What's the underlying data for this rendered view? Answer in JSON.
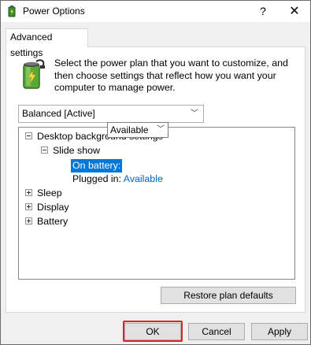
{
  "window": {
    "title": "Power Options",
    "help_glyph": "?",
    "close_glyph": "✕"
  },
  "tab": {
    "label": "Advanced settings"
  },
  "intro": {
    "line1": "Select the power plan that you want to customize, and",
    "line2": "then choose settings that reflect how you want your",
    "line3": "computer to manage power."
  },
  "plan": {
    "selected": "Balanced [Active]"
  },
  "tree": {
    "desktop_bg": "Desktop background settings",
    "slide_show": "Slide show",
    "on_battery_label": "On battery:",
    "on_battery_value": "Available",
    "plugged_in_label": "Plugged in:",
    "plugged_in_value": "Available",
    "sleep": "Sleep",
    "display": "Display",
    "battery": "Battery"
  },
  "buttons": {
    "restore": "Restore plan defaults",
    "ok": "OK",
    "cancel": "Cancel",
    "apply": "Apply"
  },
  "colors": {
    "selection": "#0078d7",
    "link": "#0066cc",
    "highlight_box": "#e0202c"
  }
}
